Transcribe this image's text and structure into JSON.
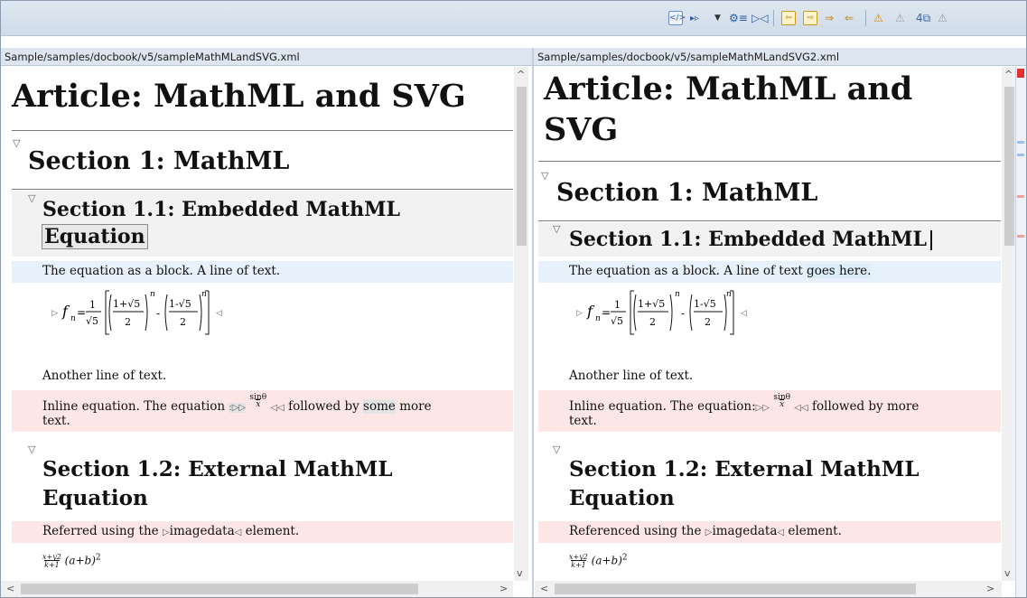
{
  "toolbar": {
    "icons": [
      "xml-source-icon",
      "filter-icon",
      "dropdown-icon",
      "options-icon",
      "split-compare-icon",
      "copy-left-icon",
      "copy-right-icon",
      "next-diff-icon",
      "prev-diff-icon",
      "merge-icon",
      "accept-icon",
      "reject-icon",
      "more-icon"
    ]
  },
  "left": {
    "path": "Sample/samples/docbook/v5/sampleMathMLandSVG.xml",
    "article_title": "Article: MathML and SVG",
    "section1": "Section 1: MathML",
    "section11_line1": "Section 1.1: Embedded MathML",
    "section11_line2": "Equation",
    "block_text": "The equation as a block. A line of text.",
    "another_line": "Another line of text.",
    "inline_before": "Inline equation. The equation ",
    "inline_after_a": " followed by ",
    "inline_some": "some",
    "inline_after_b": " more",
    "inline_text_end": "text.",
    "section12_line1": "Section 1.2: External MathML",
    "section12_line2": "Equation",
    "referred_a": "Referred",
    "referred_b": " using the ",
    "imagedata": "imagedata",
    "referred_c": " element."
  },
  "right": {
    "path": "Sample/samples/docbook/v5/sampleMathMLandSVG2.xml",
    "article_title_line1": "Article: MathML and",
    "article_title_line2": "SVG",
    "section1": "Section 1: MathML",
    "section11": "Section 1.1: Embedded MathML",
    "block_text_a": "The equation as a block. A line of text ",
    "block_text_b": "goes here.",
    "another_line": "Another line of text.",
    "inline_before": "Inline equation. The equation:",
    "inline_after": " followed by ",
    "inline_more": "more",
    "inline_text_end": "text.",
    "section12_line1": "Section 1.2: External MathML",
    "section12_line2": "Equation",
    "referenced_a": "Referenced",
    "referenced_b": " using the ",
    "imagedata": "imagedata",
    "referenced_c": " element."
  },
  "math": {
    "fn": "f",
    "sub_n": "n",
    "eq": "=",
    "one": "1",
    "sqrt5": "√5",
    "one_plus": "1+√5",
    "one_minus": "1-√5",
    "two": "2",
    "exp_n": "n",
    "minus": "-",
    "inline_num": "sinθ",
    "inline_den": "x",
    "ext_num": "x+y2",
    "ext_den": "k+1",
    "ext_tail": "(a+b)",
    "ext_exp": "2"
  },
  "colors": {
    "insert_band": "#fde6e6",
    "change_band": "#e7f1fb",
    "diff_gray": "#e4e4e4"
  }
}
